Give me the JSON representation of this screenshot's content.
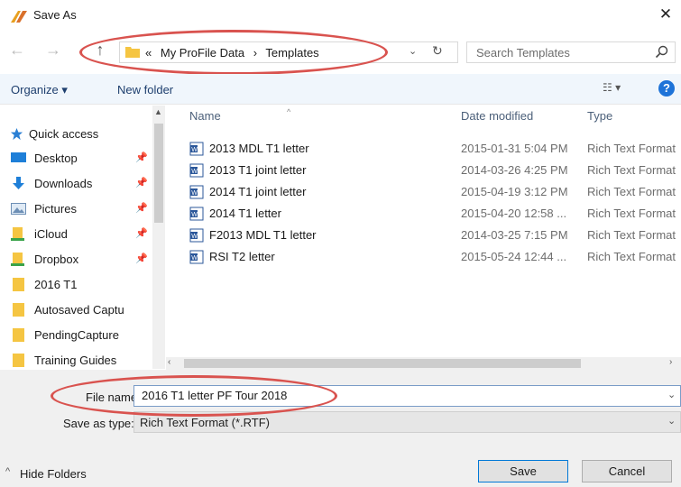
{
  "window": {
    "title": "Save As",
    "close_glyph": "✕"
  },
  "address_bar": {
    "overflow_glyph": "«",
    "crumbs": [
      "My ProFile Data",
      "Templates"
    ],
    "separator": "›",
    "dropdown_glyph": "⌄",
    "refresh_glyph": "↻"
  },
  "nav_buttons": {
    "back": "←",
    "forward": "→",
    "up": "↑"
  },
  "search": {
    "placeholder": "Search Templates"
  },
  "toolbar": {
    "organize": "Organize ▾",
    "new_folder": "New folder",
    "view": "☷ ▾",
    "help": "?"
  },
  "sidebar": {
    "items": [
      {
        "label": "Quick access",
        "icon": "star-icon"
      },
      {
        "label": "Desktop",
        "icon": "desktop-icon",
        "pinned": true
      },
      {
        "label": "Downloads",
        "icon": "download-icon",
        "pinned": true
      },
      {
        "label": "Pictures",
        "icon": "pictures-icon",
        "pinned": true
      },
      {
        "label": "iCloud",
        "icon": "folder-download-icon",
        "pinned": true
      },
      {
        "label": "Dropbox",
        "icon": "folder-download-icon",
        "pinned": true
      },
      {
        "label": "2016 T1",
        "icon": "folder-icon"
      },
      {
        "label": "Autosaved Captu",
        "icon": "folder-icon"
      },
      {
        "label": "PendingCapture",
        "icon": "folder-icon"
      },
      {
        "label": "Training Guides",
        "icon": "folder-icon"
      }
    ],
    "pin_glyph": "📌"
  },
  "file_list": {
    "columns": {
      "name": "Name",
      "date": "Date modified",
      "type": "Type"
    },
    "rows": [
      {
        "name": "2013 MDL T1 letter",
        "date": "2015-01-31 5:04 PM",
        "type": "Rich Text Format"
      },
      {
        "name": "2013 T1 joint letter",
        "date": "2014-03-26 4:25 PM",
        "type": "Rich Text Format"
      },
      {
        "name": "2014 T1 joint letter",
        "date": "2015-04-19 3:12 PM",
        "type": "Rich Text Format"
      },
      {
        "name": "2014 T1 letter",
        "date": "2015-04-20 12:58 ...",
        "type": "Rich Text Format"
      },
      {
        "name": "F2013 MDL T1 letter",
        "date": "2014-03-25 7:15 PM",
        "type": "Rich Text Format"
      },
      {
        "name": "RSI T2 letter",
        "date": "2015-05-24 12:44 ...",
        "type": "Rich Text Format"
      }
    ]
  },
  "save_form": {
    "file_name_label": "File name:",
    "file_name_value": "2016 T1 letter PF Tour 2018",
    "save_type_label": "Save as type:",
    "save_type_value": "Rich Text Format (*.RTF)"
  },
  "footer": {
    "hide_folders": "Hide Folders",
    "save": "Save",
    "cancel": "Cancel"
  },
  "colors": {
    "annotation": "#d9534f",
    "accent": "#0078d7",
    "folder": "#f5c542"
  }
}
